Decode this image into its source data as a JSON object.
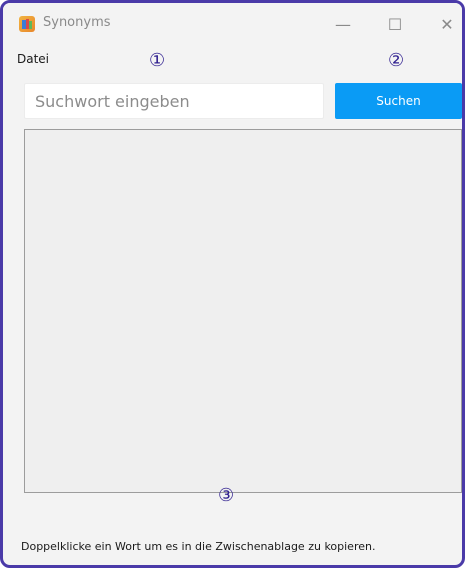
{
  "window": {
    "title": "Synonyms",
    "minimize_glyph": "—",
    "maximize_glyph": "☐",
    "close_glyph": "✕",
    "icon": "books-icon"
  },
  "menu": {
    "items": [
      {
        "label": "Datei"
      }
    ]
  },
  "search": {
    "placeholder": "Suchwort eingeben",
    "value": "",
    "button_label": "Suchen"
  },
  "results": {
    "items": []
  },
  "status": {
    "text": "Doppelklicke ein Wort um es in die Zwischenablage zu kopieren."
  },
  "annotations": {
    "marker_1": "①",
    "marker_2": "②",
    "marker_3": "③"
  },
  "colors": {
    "frame_border": "#4a3aa8",
    "button_bg": "#0a9bf5",
    "marker": "#2f1f8f"
  }
}
